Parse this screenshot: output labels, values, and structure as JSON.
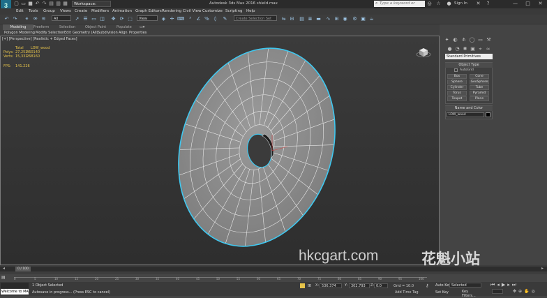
{
  "titlebar": {
    "logo": "3",
    "workspace": "Workspace: Default",
    "window_title": "Autodesk 3ds Max 2016    shield.max",
    "search_placeholder": "Type a keyword or phrase",
    "sign_in": "Sign In",
    "qa_icons": [
      "new-icon",
      "open-icon",
      "save-icon",
      "undo-icon",
      "redo-icon",
      "project-icon",
      "hold-icon",
      "fetch-icon"
    ]
  },
  "menu": {
    "items": [
      "Edit",
      "Tools",
      "Group",
      "Views",
      "Create",
      "Modifiers",
      "Animation",
      "Graph Editors",
      "Rendering",
      "Civil View",
      "Customize",
      "Scripting",
      "Help"
    ]
  },
  "toolbar": {
    "selection_filter": "All",
    "ref_coord": "View",
    "named_selection": "Create Selection Set"
  },
  "ribbon": {
    "tabs": [
      "Modeling",
      "Freeform",
      "Selection",
      "Object Paint",
      "Populate"
    ],
    "items": [
      "Polygon Modeling",
      "Modify Selection",
      "Edit",
      "Geometry (All)",
      "Subdivision",
      "Align",
      "Properties"
    ]
  },
  "viewport": {
    "label": "[+] [Perspective] [Realistic + Edged Faces]",
    "stats": {
      "total_label": "Total",
      "object_name": "LOW_wood",
      "polys_label": "Polys:",
      "polys_total": "27,252",
      "polys_obj": "460140",
      "verts_label": "Verts:",
      "verts_total": "15,332",
      "verts_obj": "268160",
      "fps_label": "FPS:",
      "fps": "141.226"
    }
  },
  "command_panel": {
    "primitive_type": "Standard Primitives",
    "object_type_title": "Object Type",
    "autogrid": "AutoGrid",
    "buttons": [
      "Box",
      "Cone",
      "Sphere",
      "GeoSphere",
      "Cylinder",
      "Tube",
      "Torus",
      "Pyramid",
      "Teapot",
      "Plane"
    ],
    "name_color_title": "Name and Color",
    "object_name": "LOW_wood"
  },
  "timeline": {
    "frame": "0 / 100",
    "ticks": [
      "0",
      "5",
      "10",
      "15",
      "20",
      "25",
      "30",
      "35",
      "40",
      "45",
      "50",
      "55",
      "60",
      "65",
      "70",
      "75",
      "80",
      "85",
      "90",
      "95",
      "100"
    ]
  },
  "status": {
    "maxscript": "Welcome to MA",
    "selected": "1 Object Selected",
    "prompt": "Autosave in progress... (Press ESC to cancel)",
    "x_label": "X:",
    "x_val": "536.374",
    "y_label": "Y:",
    "y_val": "302.793",
    "z_label": "Z:",
    "z_val": "0.0",
    "grid": "Grid = 10.0",
    "add_time_tag": "Add Time Tag",
    "auto_key": "Auto Key",
    "set_key": "Set Key",
    "key_mode": "Selected",
    "key_filters": "Key Filters..."
  },
  "watermark": {
    "text": "hkcgart.com",
    "cn": "花魁小站"
  },
  "colors": {
    "selection_outline": "#3fc8f0",
    "stats": "#e6c34a",
    "mesh_face": "#8e8e8e"
  }
}
